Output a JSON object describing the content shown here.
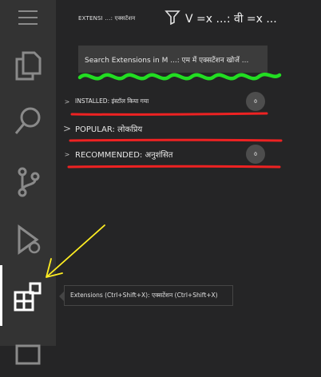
{
  "activity_bar": {
    "items": [
      {
        "name": "menu-icon"
      },
      {
        "name": "explorer-icon"
      },
      {
        "name": "search-icon"
      },
      {
        "name": "source-control-icon"
      },
      {
        "name": "run-debug-icon"
      },
      {
        "name": "extensions-icon",
        "active": true
      },
      {
        "name": "remote-icon"
      }
    ]
  },
  "sidebar": {
    "title": "EXTENSI ...: एक्सटेंशन",
    "shortcuts": "V =x ...: वी =x ...",
    "search_placeholder": "Search Extensions in M ...: एम में एक्सटेंशन खोजें ...",
    "sections": [
      {
        "label": "INSTALLED: इंस्टॉल किया गया",
        "chevron": ">",
        "badge": "0"
      },
      {
        "label": "POPULAR: लोकप्रिय",
        "chevron": ">"
      },
      {
        "label": "RECOMMENDED: अनुशंसित",
        "chevron": ">",
        "badge": "0"
      }
    ]
  },
  "tooltip": {
    "text": "Extensions (Ctrl+Shift+X): एक्सटेंशन (Ctrl+Shift+X)"
  },
  "annotations": {
    "underline_color": "#22dd22",
    "marker_color": "#ee2222",
    "arrow_color": "#ffee22"
  }
}
